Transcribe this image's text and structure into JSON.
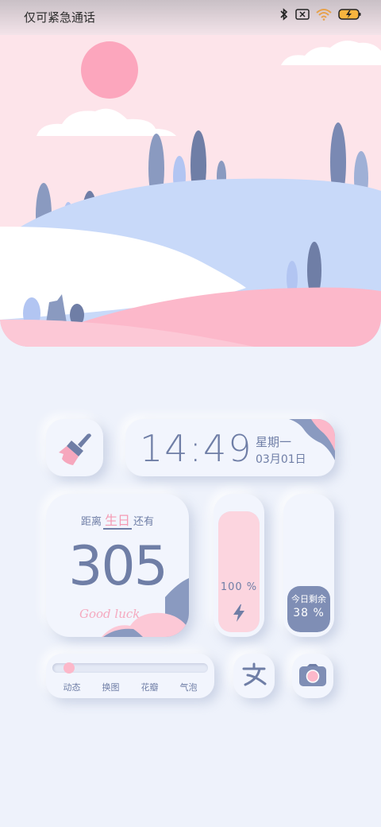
{
  "status_bar": {
    "carrier_text": "仅可紧急通话",
    "icons": [
      "bluetooth-icon",
      "no-sim-icon",
      "wifi-icon",
      "battery-charging-icon"
    ]
  },
  "clock_widget": {
    "time": "14:49",
    "weekday": "星期一",
    "date": "03月01日"
  },
  "birthday_widget": {
    "prefix": "距离",
    "highlight": "生日",
    "suffix": "还有",
    "days": "305",
    "tagline": "Good luck"
  },
  "battery_widget": {
    "percent_text": "100 %",
    "level": 1.0
  },
  "day_left_widget": {
    "label": "今日剩余",
    "value_text": "38 %",
    "level": 0.38
  },
  "effect_widget": {
    "options": [
      "动态",
      "换图",
      "花瓣",
      "气泡"
    ]
  },
  "colors": {
    "accent_blue": "#6f7ea6",
    "accent_pink": "#f49ab3",
    "background": "#eef2fb",
    "sky": "#fde4ea"
  },
  "shortcuts": [
    "cleaner-icon",
    "alipay-icon",
    "camera-icon"
  ]
}
